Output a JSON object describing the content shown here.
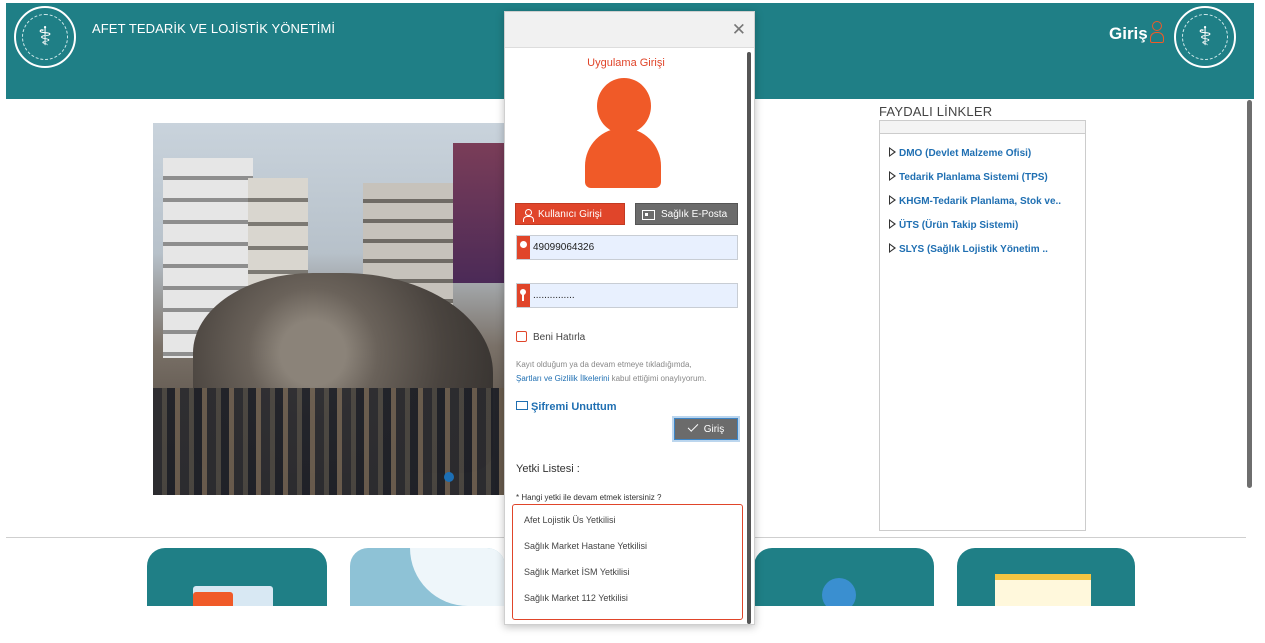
{
  "header": {
    "app_title": "AFET TEDARİK VE LOJİSTİK YÖNETİMİ",
    "login_label": "Giriş",
    "logo_left": "ministry-emblem",
    "logo_right": "ministry-emblem"
  },
  "links": {
    "title": "FAYDALI LİNKLER",
    "items": [
      {
        "label": "DMO (Devlet Malzeme Ofisi)"
      },
      {
        "label": "Tedarik Planlama Sistemi (TPS)"
      },
      {
        "label": "KHGM-Tedarik Planlama, Stok ve.."
      },
      {
        "label": "ÜTS (Ürün Takip Sistemi)"
      },
      {
        "label": "SLYS (Sağlık Lojistik Yönetim .."
      }
    ]
  },
  "modal": {
    "close_glyph": "✕",
    "title": "Uygulama Girişi",
    "tab_user_label": "Kullanıcı Girişi",
    "tab_mail_label": "Sağlık E-Posta",
    "username_value": "49099064326",
    "password_value": "...............",
    "remember_label": "Beni Hatırla",
    "terms_pre": "Kayıt olduğum ya da devam etmeye tıkladığımda,",
    "terms_link": "Şartları ve Gizlilik İlkelerini",
    "terms_post": " kabul ettiğimi onaylıyorum.",
    "forgot_label": "Şifremi Unuttum",
    "login_button": "Giriş",
    "roles_title": "Yetki Listesi :",
    "roles_question": "* Hangi yetki ile devam etmek istersiniz ?",
    "roles": [
      "Afet Lojistik Üs Yetkilisi",
      "Sağlık Market Hastane Yetkilisi",
      "Sağlık Market İSM Yetkilisi",
      "Sağlık Market 112 Yetkilisi"
    ]
  },
  "colors": {
    "header_bg": "#1f7f86",
    "accent_orange": "#e0452a",
    "link_blue": "#1f6fb2"
  }
}
